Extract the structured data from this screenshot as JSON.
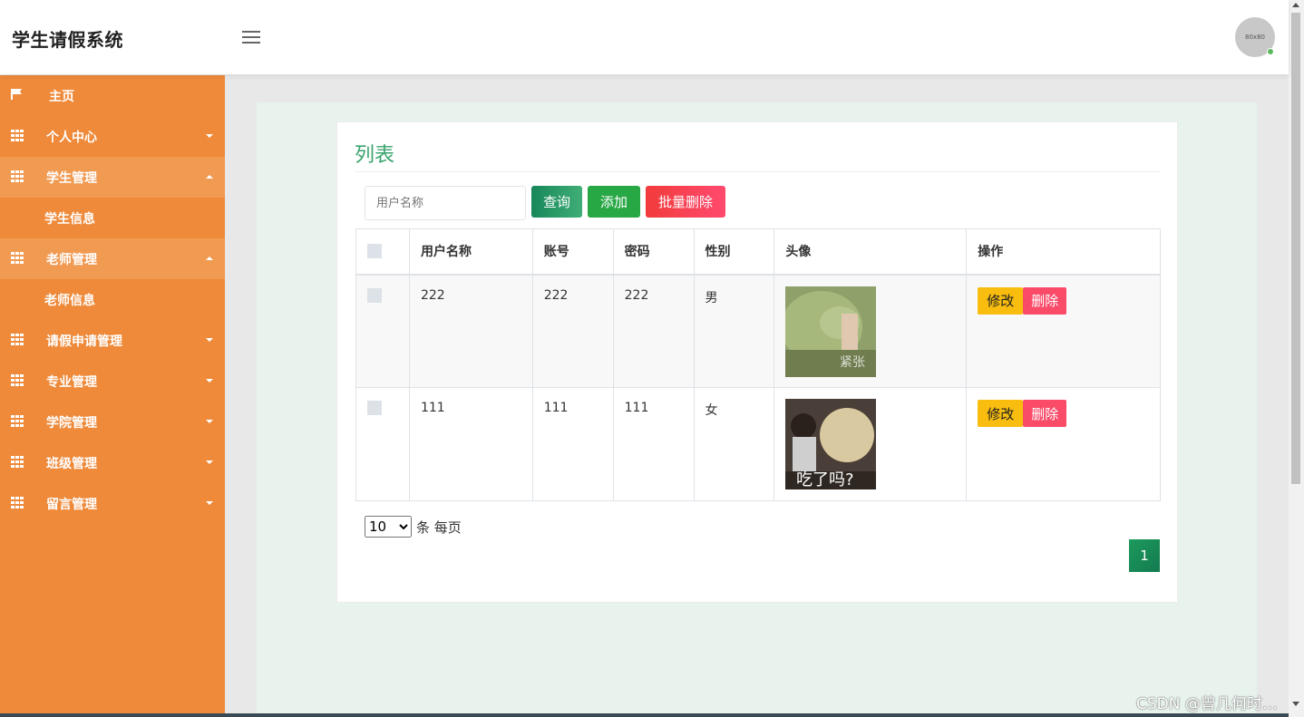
{
  "header": {
    "brand": "学生请假系统",
    "avatar_text": "80x80"
  },
  "sidebar": {
    "items": [
      {
        "label": "主页"
      },
      {
        "label": "个人中心"
      },
      {
        "label": "学生管理"
      },
      {
        "label": "学生信息"
      },
      {
        "label": "老师管理"
      },
      {
        "label": "老师信息"
      },
      {
        "label": "请假申请管理"
      },
      {
        "label": "专业管理"
      },
      {
        "label": "学院管理"
      },
      {
        "label": "班级管理"
      },
      {
        "label": "留言管理"
      }
    ]
  },
  "main": {
    "title": "列表",
    "search_placeholder": "用户名称",
    "query_label": "查询",
    "add_label": "添加",
    "batch_delete_label": "批量删除",
    "columns": [
      "用户名称",
      "账号",
      "密码",
      "性别",
      "头像",
      "操作"
    ],
    "rows": [
      {
        "username": "222",
        "account": "222",
        "password": "222",
        "gender": "男",
        "avatar_caption": "紧张",
        "edit": "修改",
        "delete": "删除"
      },
      {
        "username": "111",
        "account": "111",
        "password": "111",
        "gender": "女",
        "avatar_caption": "吃了吗?",
        "edit": "修改",
        "delete": "删除"
      }
    ],
    "page_size_value": "10",
    "page_size_suffix": "条 每页",
    "current_page": "1"
  },
  "watermark": "CSDN @曾几何时…",
  "colors": {
    "sidebar": "#ee8a3a",
    "accent_green": "#3aa46d",
    "add_green": "#28a745",
    "danger": "#fa4b69",
    "warning": "#f8bd0e"
  }
}
